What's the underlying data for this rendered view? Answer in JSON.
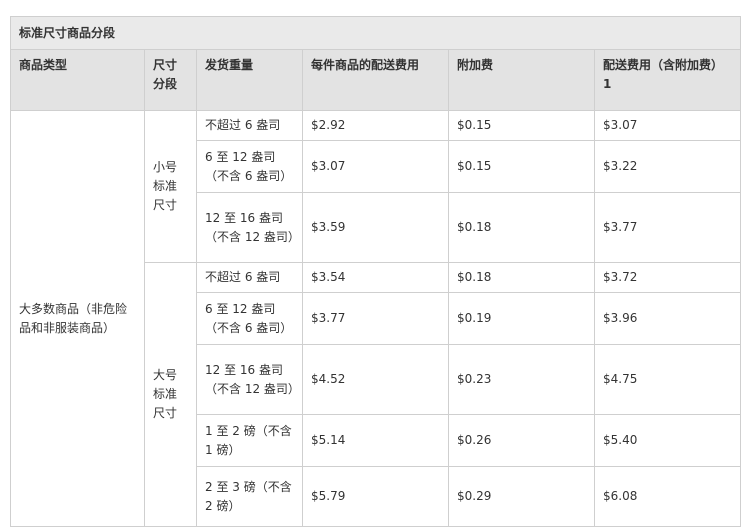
{
  "table": {
    "title": "标准尺寸商品分段",
    "headers": {
      "category": "商品类型",
      "size": "尺寸分段",
      "weight": "发货重量",
      "fee": "每件商品的配送费用",
      "surcharge": "附加费",
      "total": "配送费用（含附加费）",
      "total_note": "1"
    },
    "category": "大多数商品（非危险品和非服装商品）",
    "groups": [
      {
        "size_label": "小号标准尺寸",
        "rows": [
          {
            "weight": "不超过 6 盎司",
            "fee": "$2.92",
            "surcharge": "$0.15",
            "total": "$3.07"
          },
          {
            "weight": "6 至 12 盎司（不含 6 盎司）",
            "fee": "$3.07",
            "surcharge": "$0.15",
            "total": "$3.22"
          },
          {
            "weight": "12 至 16 盎司（不含 12 盎司）",
            "fee": "$3.59",
            "surcharge": "$0.18",
            "total": "$3.77"
          }
        ]
      },
      {
        "size_label": "大号标准尺寸",
        "rows": [
          {
            "weight": "不超过 6 盎司",
            "fee": "$3.54",
            "surcharge": "$0.18",
            "total": "$3.72"
          },
          {
            "weight": "6 至 12 盎司（不含 6 盎司）",
            "fee": "$3.77",
            "surcharge": "$0.19",
            "total": "$3.96"
          },
          {
            "weight": "12 至 16 盎司（不含 12 盎司）",
            "fee": "$4.52",
            "surcharge": "$0.23",
            "total": "$4.75"
          },
          {
            "weight": "1 至 2 磅（不含 1 磅）",
            "fee": "$5.14",
            "surcharge": "$0.26",
            "total": "$5.40"
          },
          {
            "weight": "2 至 3 磅（不含 2 磅）",
            "fee": "$5.79",
            "surcharge": "$0.29",
            "total": "$6.08"
          }
        ]
      }
    ]
  }
}
